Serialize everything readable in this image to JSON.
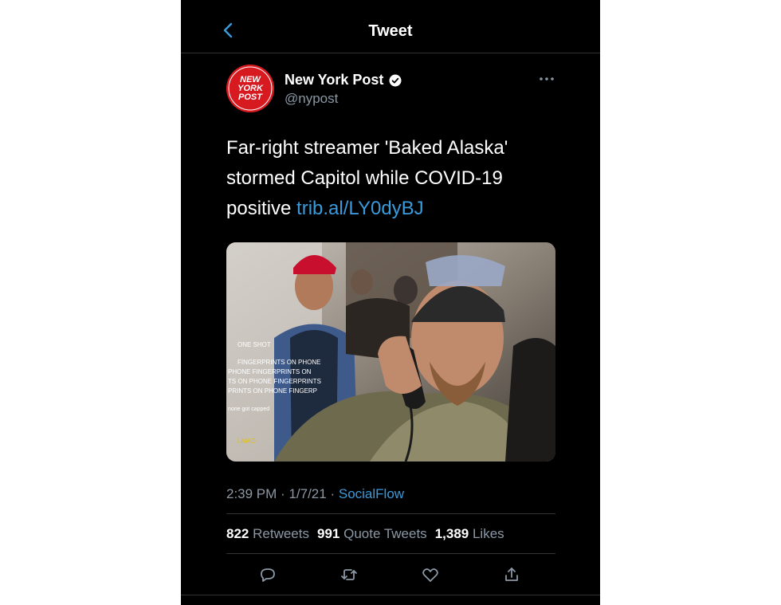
{
  "header": {
    "title": "Tweet",
    "back_icon": "chevron-left-icon"
  },
  "author": {
    "name": "New York Post",
    "handle": "@nypost",
    "avatar_text": [
      "NEW",
      "YORK",
      "POST"
    ],
    "verified": true
  },
  "tweet": {
    "text_lines": [
      "Far-right streamer 'Baked Alaska'",
      "stormed Capitol while COVID-19",
      "positive "
    ],
    "link": "trib.al/LY0dyBJ"
  },
  "media": {
    "overlay_lines": [
      "ONE SHOT",
      "FINGERPRINTS ON PHONE",
      "PHONE FINGERPRINTS ON",
      "TS ON PHONE FINGERPRINTS",
      "PRINTS ON PHONE FINGERP",
      "none got capped",
      "LMAO"
    ]
  },
  "meta": {
    "time": "2:39 PM",
    "date": "1/7/21",
    "source": "SocialFlow"
  },
  "stats": {
    "retweets_count": "822",
    "retweets_label": "Retweets",
    "quotes_count": "991",
    "quotes_label": "Quote Tweets",
    "likes_count": "1,389",
    "likes_label": "Likes"
  },
  "actions": [
    "reply-icon",
    "retweet-icon",
    "like-icon",
    "share-icon"
  ],
  "colors": {
    "background": "#000000",
    "link": "#3a9bdc",
    "muted": "#8b98a5",
    "brand_red": "#d71920"
  }
}
